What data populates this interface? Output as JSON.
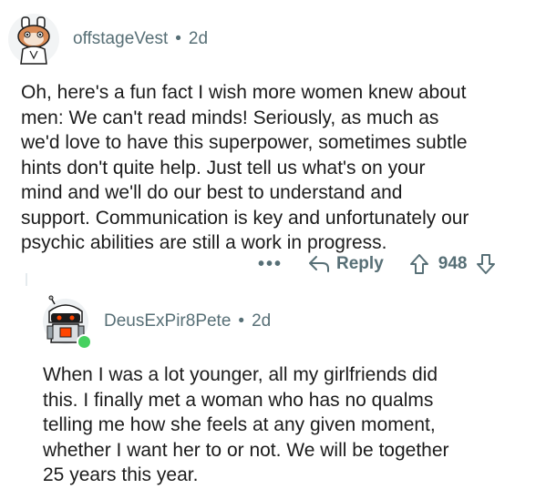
{
  "comments": [
    {
      "username": "offstageVest",
      "separator": "•",
      "age": "2d",
      "text": "Oh, here's a fun fact I wish more women knew about\nmen: We can't read minds! Seriously, as much as\nwe'd love to have this superpower, sometimes subtle\nhints don't quite help. Just tell us what's on your\nmind and we'll do our best to understand and\nsupport. Communication is key and unfortunately our\npsychic abilities are still a work in progress.",
      "actions": {
        "more": "•••",
        "reply_label": "Reply",
        "score": "948"
      }
    },
    {
      "username": "DeusExPir8Pete",
      "separator": "•",
      "age": "2d",
      "text": "When I was a lot younger, all my girlfriends did\nthis. I finally met a woman who has no qualms\ntelling me how she feels at any given moment,\nwhether I want her to or not. We will be together\n25 years this year."
    }
  ],
  "colors": {
    "meta_gray": "#576f76",
    "text": "#1c1c1c",
    "online": "#46d160",
    "thread_line": "#e5ebee"
  },
  "icons": [
    "snoo-avatar-icon",
    "reply-arrow-icon",
    "upvote-arrow-icon",
    "downvote-arrow-icon",
    "robot-snoo-avatar-icon"
  ]
}
